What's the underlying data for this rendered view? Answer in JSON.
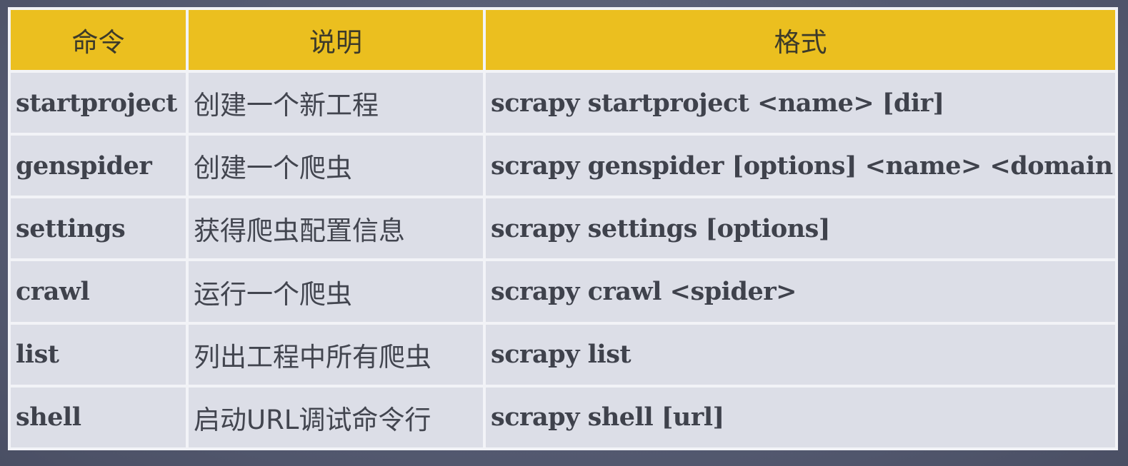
{
  "table": {
    "headers": [
      "命令",
      "说明",
      "格式"
    ],
    "rows": [
      {
        "command": "startproject",
        "description": "创建一个新工程",
        "format": "scrapy startproject <name> [dir]"
      },
      {
        "command": "genspider",
        "description": "创建一个爬虫",
        "format": "scrapy genspider [options] <name> <domain>"
      },
      {
        "command": "settings",
        "description": "获得爬虫配置信息",
        "format": "scrapy settings [options]"
      },
      {
        "command": "crawl",
        "description": "运行一个爬虫",
        "format": "scrapy crawl <spider>"
      },
      {
        "command": "list",
        "description": "列出工程中所有爬虫",
        "format": "scrapy list"
      },
      {
        "command": "shell",
        "description": "启动URL调试命令行",
        "format": "scrapy shell [url]"
      }
    ]
  },
  "colors": {
    "header_bg": "#ebbf1f",
    "cell_bg": "#dcdee7",
    "border": "#f2f3f7",
    "page_bg": "#555b72"
  }
}
